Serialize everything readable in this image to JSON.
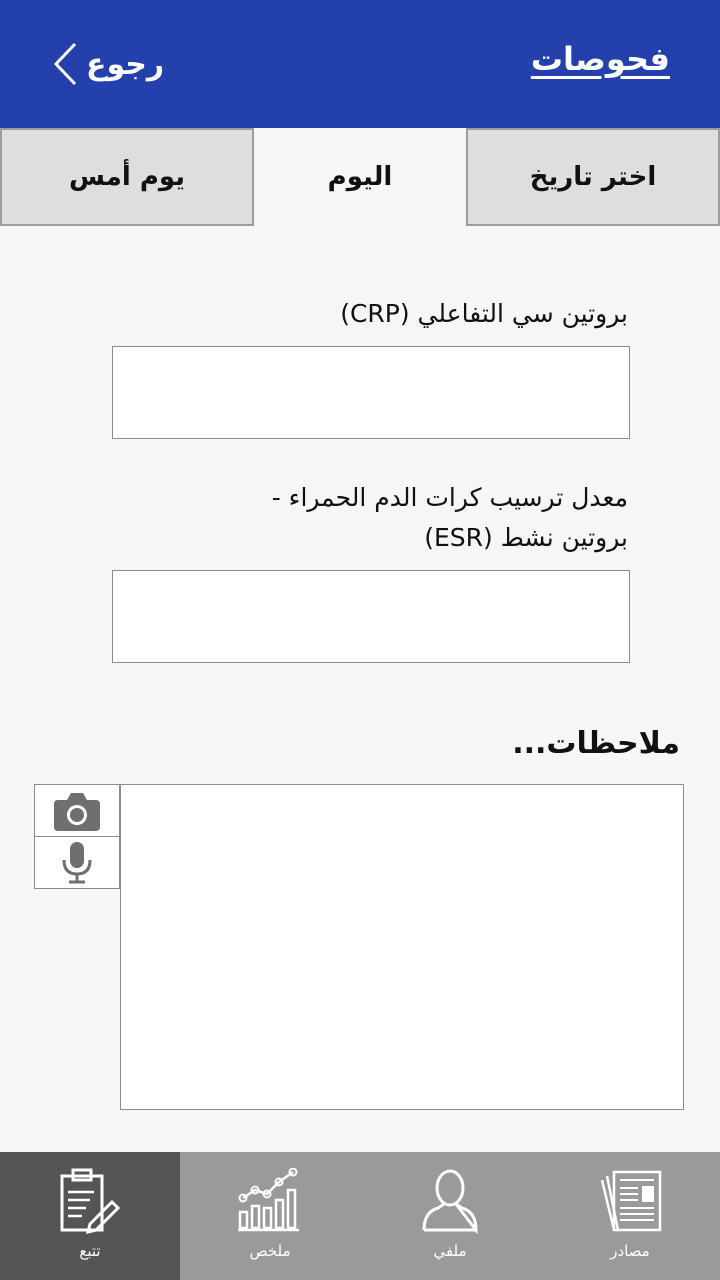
{
  "header": {
    "title": "فحوصات",
    "back_label": "رجوع"
  },
  "tabs": [
    {
      "label": "يوم أمس",
      "active": false
    },
    {
      "label": "اليوم",
      "active": true
    },
    {
      "label": "اختر تاريخ",
      "active": false
    }
  ],
  "fields": {
    "crp": {
      "label": "بروتين سي التفاعلي (CRP)",
      "value": ""
    },
    "esr": {
      "label_line1": "معدل ترسيب كرات الدم الحمراء -",
      "label_line2": "بروتين نشط (ESR)",
      "value": ""
    }
  },
  "notes": {
    "title": "ملاحظات...",
    "value": ""
  },
  "media_buttons": [
    {
      "icon": "camera-icon"
    },
    {
      "icon": "microphone-icon"
    }
  ],
  "bottom_nav": [
    {
      "label": "تتبع",
      "icon": "tracking-clipboard-icon",
      "active": true
    },
    {
      "label": "ملخص",
      "icon": "summary-chart-icon",
      "active": false
    },
    {
      "label": "ملفي",
      "icon": "profile-person-icon",
      "active": false
    },
    {
      "label": "مصادر",
      "icon": "resources-newspaper-icon",
      "active": false
    }
  ],
  "colors": {
    "header_bg": "#2340ad",
    "nav_bg": "#9a9a9a",
    "nav_active_bg": "#555555",
    "tab_inactive_bg": "#dedede"
  }
}
